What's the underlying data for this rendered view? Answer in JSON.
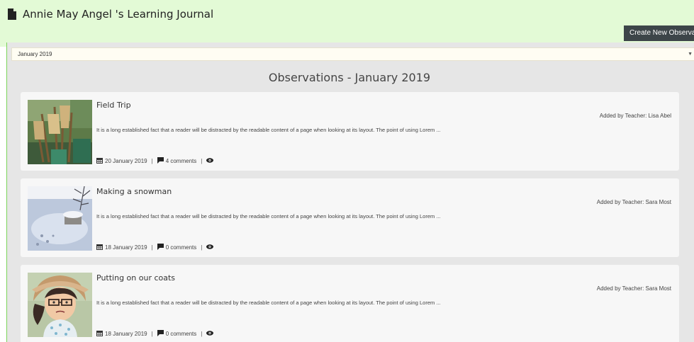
{
  "header": {
    "title": "Annie May Angel 's Learning Journal",
    "create_button": "Create New Observation"
  },
  "filter": {
    "selected_month": "January 2019"
  },
  "page_title": "Observations - January 2019",
  "observations": [
    {
      "title": "Field Trip",
      "teacher": "Added by Teacher: Lisa Abel",
      "excerpt": "It is a long established fact that a reader will be distracted by the readable content of a page when looking at its layout. The point of using Lorem ...",
      "date": "20 January 2019",
      "comments": "4 comments",
      "thumbnail": "brooms-photo"
    },
    {
      "title": "Making a snowman",
      "teacher": "Added by Teacher: Sara Most",
      "excerpt": "It is a long established fact that a reader will be distracted by the readable content of a page when looking at its layout. The point of using Lorem ...",
      "date": "18 January 2019",
      "comments": "0 comments",
      "thumbnail": "snow-photo"
    },
    {
      "title": "Putting on our coats",
      "teacher": "Added by Teacher: Sara Most",
      "excerpt": "It is a long established fact that a reader will be distracted by the readable content of a page when looking at its layout. The point of using Lorem ...",
      "date": "18 January 2019",
      "comments": "0 comments",
      "thumbnail": "cartoon-girl-avatar"
    }
  ],
  "icons": {
    "document": "file-icon",
    "calendar": "calendar-icon",
    "comment": "comment-icon",
    "view": "eye-icon",
    "dropdown": "caret-down-icon"
  },
  "colors": {
    "header_bg": "#e3fad6",
    "button_bg": "#3d4549",
    "content_bg": "#e6e6e6",
    "card_bg": "#f7f7f7"
  }
}
